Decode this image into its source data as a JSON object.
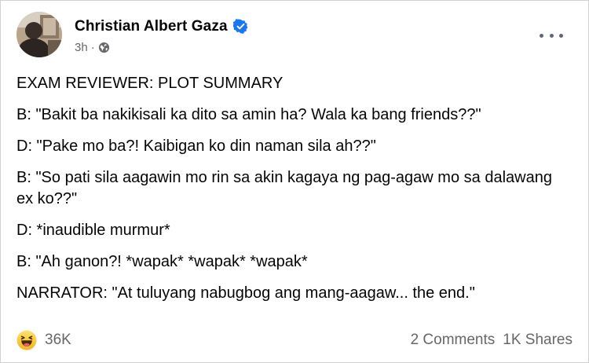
{
  "post": {
    "author": "Christian Albert Gaza",
    "time": "3h",
    "separator": "·",
    "verified_icon": "verified-badge-icon",
    "privacy_icon": "globe-icon",
    "more_icon": "more-options-icon",
    "lines": [
      "EXAM REVIEWER: PLOT SUMMARY",
      "B: \"Bakit ba nakikisali ka dito sa amin ha? Wala ka bang friends??\"",
      "D: \"Pake mo ba?! Kaibigan ko din naman sila ah??\"",
      "B: \"So pati sila aagawin mo rin sa akin kagaya ng pag-agaw mo sa dalawang ex ko??\"",
      "D: *inaudible murmur*",
      "B: \"Ah ganon?! *wapak* *wapak* *wapak*",
      "NARRATOR: \"At tuluyang nabugbog ang mang-aagaw... the end.\""
    ],
    "reaction_icon": "haha-emoji-icon",
    "reaction_count": "36K",
    "comments": "2 Comments",
    "shares": "1K Shares"
  },
  "colors": {
    "verified_blue": "#1877f2",
    "haha_yellow": "#f7c33b",
    "secondary_text": "#65676b"
  }
}
